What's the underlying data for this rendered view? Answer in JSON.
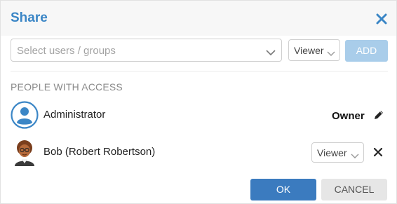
{
  "dialog": {
    "title": "Share",
    "close_icon": "close-icon"
  },
  "add_row": {
    "search_placeholder": "Select users / groups",
    "role_value": "Viewer",
    "add_label": "ADD"
  },
  "access": {
    "section_label": "PEOPLE WITH ACCESS",
    "entries": [
      {
        "name": "Administrator",
        "role": "Owner",
        "avatar": "user-circle-icon",
        "action_icon": "pencil-icon"
      },
      {
        "name": "Bob (Robert Robertson)",
        "role": "Viewer",
        "avatar": "person-avatar",
        "action_icon": "close-icon"
      }
    ]
  },
  "footer": {
    "ok_label": "OK",
    "cancel_label": "CANCEL"
  },
  "colors": {
    "accent": "#3b86c6",
    "primary_button": "#3b7bbf",
    "disabled_button": "#a9cdea",
    "secondary_button": "#e6e6e6"
  }
}
